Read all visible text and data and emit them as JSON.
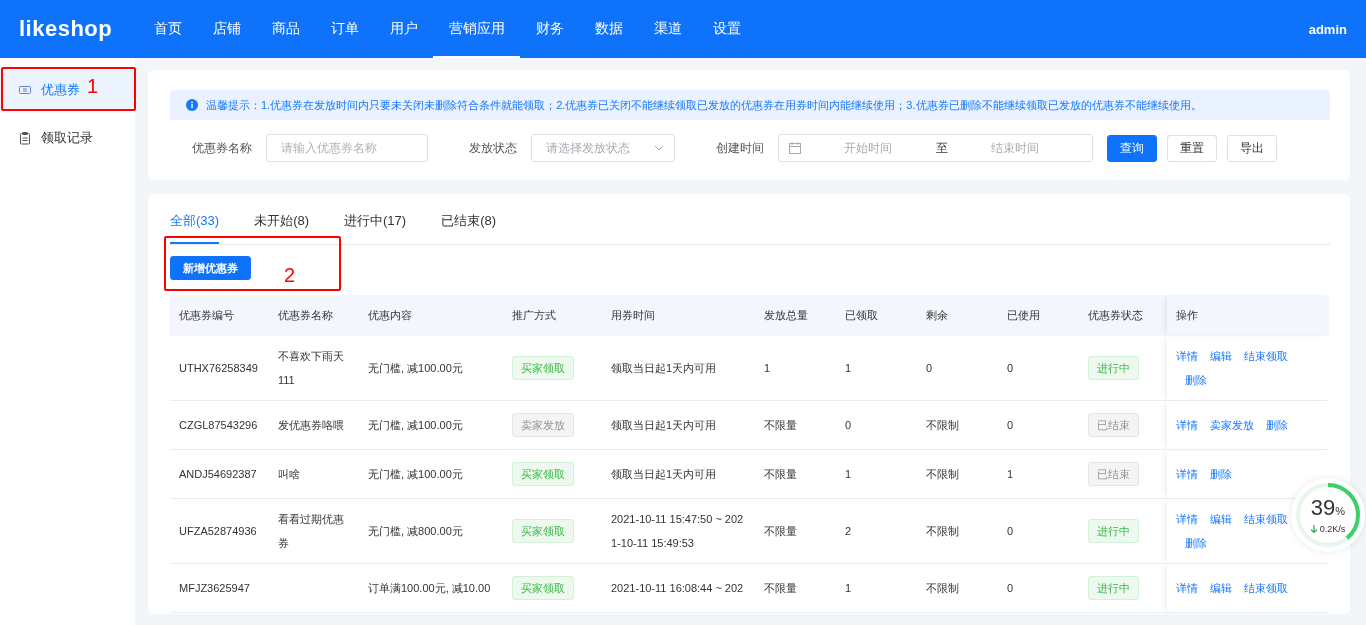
{
  "header": {
    "logo": "likeshop",
    "nav": [
      {
        "label": "首页",
        "selected": false
      },
      {
        "label": "店铺",
        "selected": false
      },
      {
        "label": "商品",
        "selected": false
      },
      {
        "label": "订单",
        "selected": false
      },
      {
        "label": "用户",
        "selected": false
      },
      {
        "label": "营销应用",
        "selected": true
      },
      {
        "label": "财务",
        "selected": false
      },
      {
        "label": "数据",
        "selected": false
      },
      {
        "label": "渠道",
        "selected": false
      },
      {
        "label": "设置",
        "selected": false
      }
    ],
    "user": "admin"
  },
  "sidebar": {
    "items": [
      {
        "label": "优惠券",
        "kind": "ticket",
        "selected": true,
        "annotation": "1"
      },
      {
        "label": "领取记录",
        "kind": "clipboard",
        "selected": false
      }
    ]
  },
  "notice": "温馨提示：1.优惠券在发放时间内只要未关闭未删除符合条件就能领取；2.优惠券已关闭不能继续领取已发放的优惠券在用券时间内能继续使用；3.优惠券已删除不能继续领取已发放的优惠券不能继续使用。",
  "filters": {
    "name_label": "优惠券名称",
    "name_placeholder": "请输入优惠券名称",
    "status_label": "发放状态",
    "status_placeholder": "请选择发放状态",
    "time_label": "创建时间",
    "start_placeholder": "开始时间",
    "range_separator": "至",
    "end_placeholder": "结束时间",
    "buttons": [
      {
        "label": "查询",
        "kind": "primary"
      },
      {
        "label": "重置",
        "kind": "plain"
      },
      {
        "label": "导出",
        "kind": "plain"
      }
    ]
  },
  "tabs": [
    {
      "label": "全部(33)",
      "selected": true
    },
    {
      "label": "未开始(8)",
      "selected": false
    },
    {
      "label": "进行中(17)",
      "selected": false
    },
    {
      "label": "已结束(8)",
      "selected": false
    }
  ],
  "add_button": {
    "label": "新增优惠券",
    "annotation": "2"
  },
  "table": {
    "columns": [
      "优惠券编号",
      "优惠券名称",
      "优惠内容",
      "推广方式",
      "用券时间",
      "发放总量",
      "已领取",
      "剩余",
      "已使用",
      "优惠券状态",
      "操作"
    ],
    "rows": [
      {
        "code": "UTHX76258349",
        "name": "不喜欢下雨天111",
        "content": "无门槛, 减100.00元",
        "method": {
          "text": "买家领取",
          "kind": "buyer"
        },
        "time": "领取当日起1天内可用",
        "total": "1",
        "received": "1",
        "remaining": "0",
        "used": "0",
        "status": {
          "text": "进行中",
          "kind": "active"
        },
        "actions": [
          "详情",
          "编辑",
          "结束领取",
          "删除"
        ]
      },
      {
        "code": "CZGL87543296",
        "name": "发优惠券咯喂",
        "content": "无门槛, 减100.00元",
        "method": {
          "text": "卖家发放",
          "kind": "seller"
        },
        "time": "领取当日起1天内可用",
        "total": "不限量",
        "received": "0",
        "remaining": "不限制",
        "used": "0",
        "status": {
          "text": "已结束",
          "kind": "ended"
        },
        "actions": [
          "详情",
          "卖家发放",
          "删除"
        ]
      },
      {
        "code": "ANDJ54692387",
        "name": "叫啥",
        "content": "无门槛, 减100.00元",
        "method": {
          "text": "买家领取",
          "kind": "buyer"
        },
        "time": "领取当日起1天内可用",
        "total": "不限量",
        "received": "1",
        "remaining": "不限制",
        "used": "1",
        "status": {
          "text": "已结束",
          "kind": "ended"
        },
        "actions": [
          "详情",
          "删除"
        ]
      },
      {
        "code": "UFZA52874936",
        "name": "看看过期优惠券",
        "content": "无门槛, 减800.00元",
        "method": {
          "text": "买家领取",
          "kind": "buyer"
        },
        "time": "2021-10-11 15:47:50 ~ 2021-10-11 15:49:53",
        "total": "不限量",
        "received": "2",
        "remaining": "不限制",
        "used": "0",
        "status": {
          "text": "进行中",
          "kind": "active"
        },
        "actions": [
          "详情",
          "编辑",
          "结束领取",
          "删除"
        ]
      },
      {
        "code": "MFJZ3625947",
        "content": "订单满100.00元, 减10.00",
        "method": {
          "text": "买家领取",
          "kind": "buyer"
        },
        "time": "2021-10-11 16:08:44 ~ 202",
        "total": "不限量",
        "received": "1",
        "remaining": "不限制",
        "used": "0",
        "status": {
          "text": "进行中",
          "kind": "active"
        },
        "actions": [
          "详情",
          "编辑",
          "结束领取"
        ]
      }
    ]
  },
  "speed_widget": {
    "percent": "39",
    "unit": "%",
    "speed": "0.2K/s",
    "level": 0.39
  }
}
